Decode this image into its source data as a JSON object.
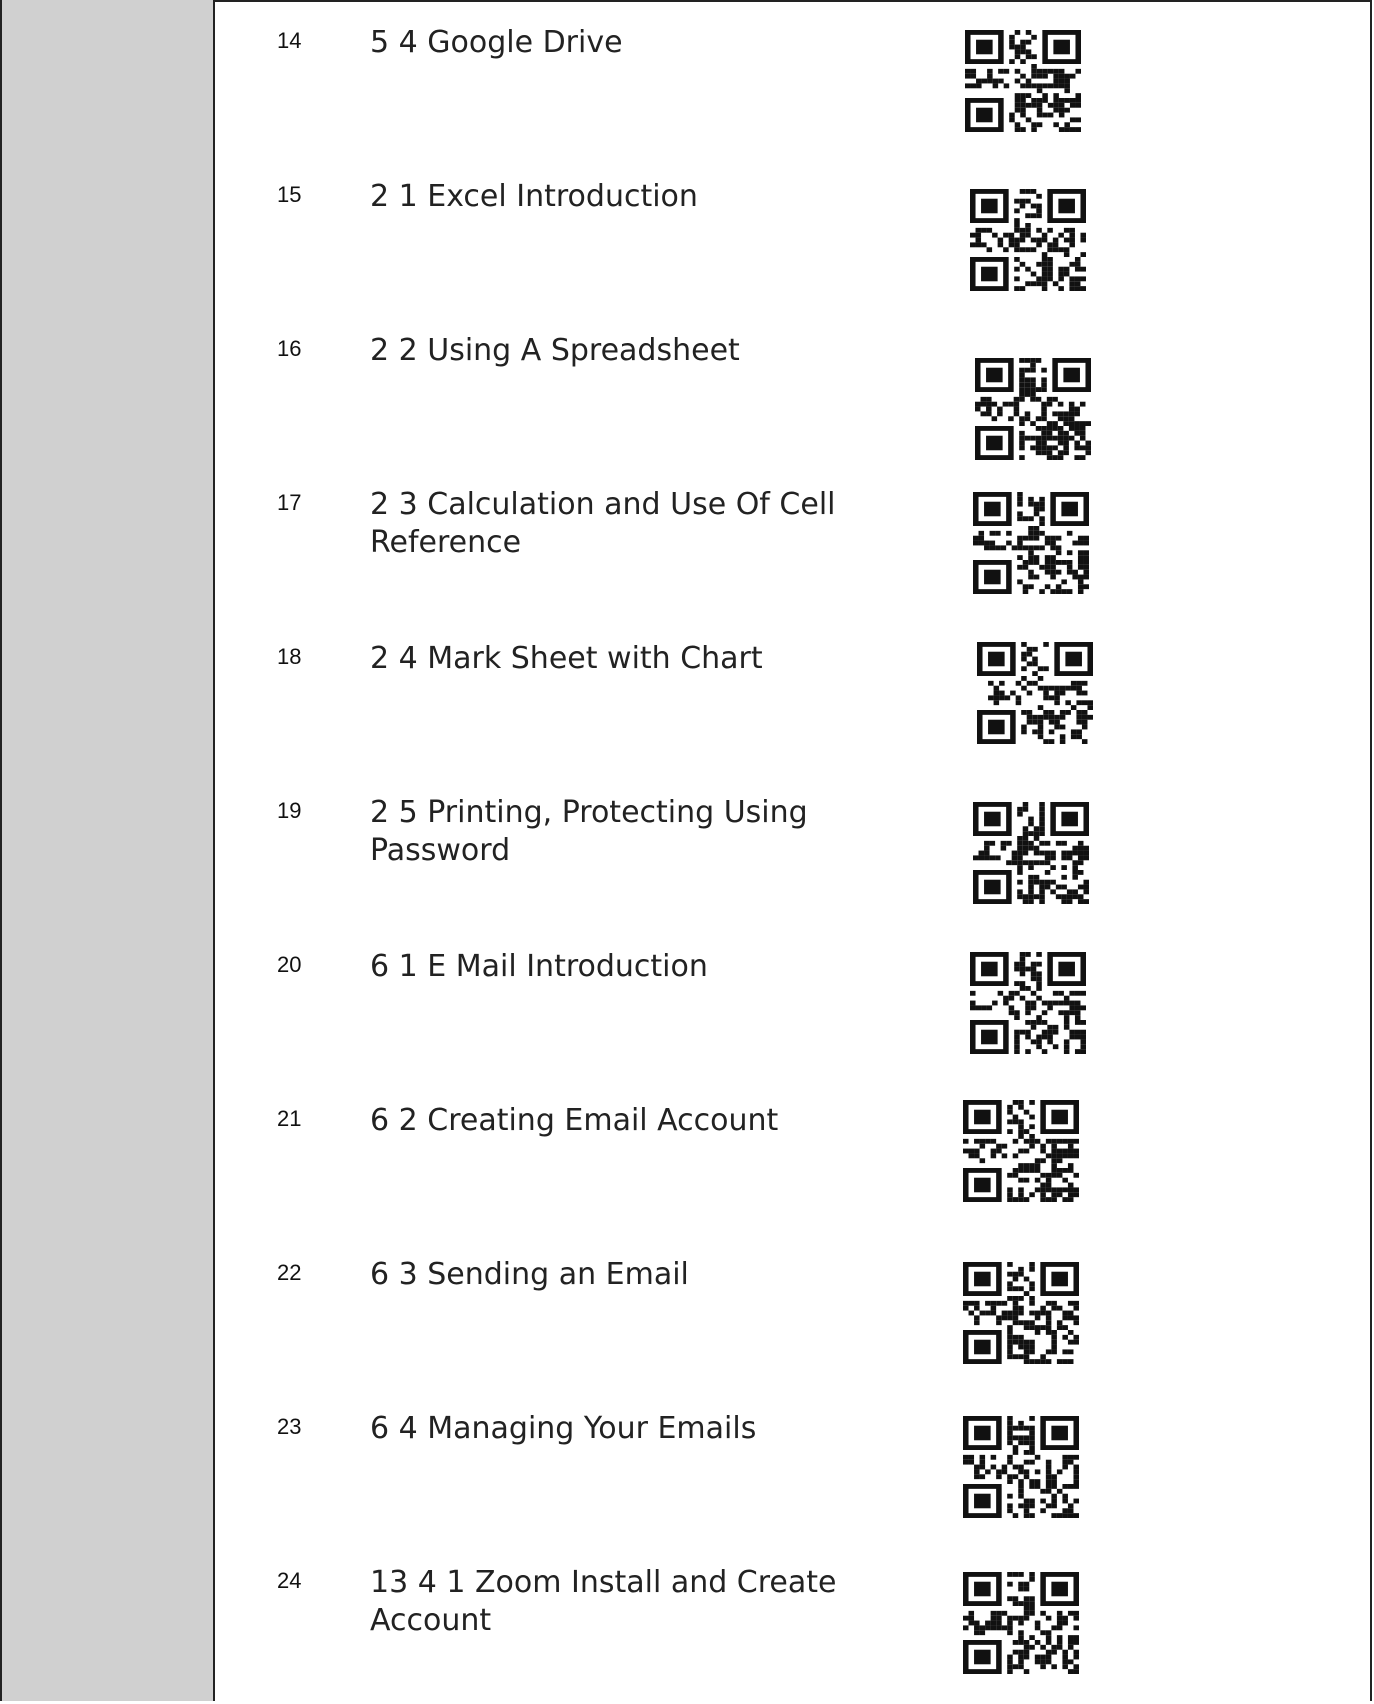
{
  "entries": [
    {
      "num": "14",
      "title": "5 4 Google Drive"
    },
    {
      "num": "15",
      "title": "2 1 Excel Introduction"
    },
    {
      "num": "16",
      "title": "2 2 Using A Spreadsheet"
    },
    {
      "num": "17",
      "title": "2 3 Calculation and Use Of Cell Reference"
    },
    {
      "num": "18",
      "title": "2 4 Mark Sheet with Chart"
    },
    {
      "num": "19",
      "title": "2 5 Printing, Protecting Using Password"
    },
    {
      "num": "20",
      "title": "6 1 E Mail Introduction"
    },
    {
      "num": "21",
      "title": "6 2 Creating Email Account"
    },
    {
      "num": "22",
      "title": "6 3 Sending an Email"
    },
    {
      "num": "23",
      "title": "6 4 Managing Your Emails"
    },
    {
      "num": "24",
      "title": "13 4 1 Zoom Install and Create Account"
    }
  ],
  "qr_icon": "qr-code-icon"
}
